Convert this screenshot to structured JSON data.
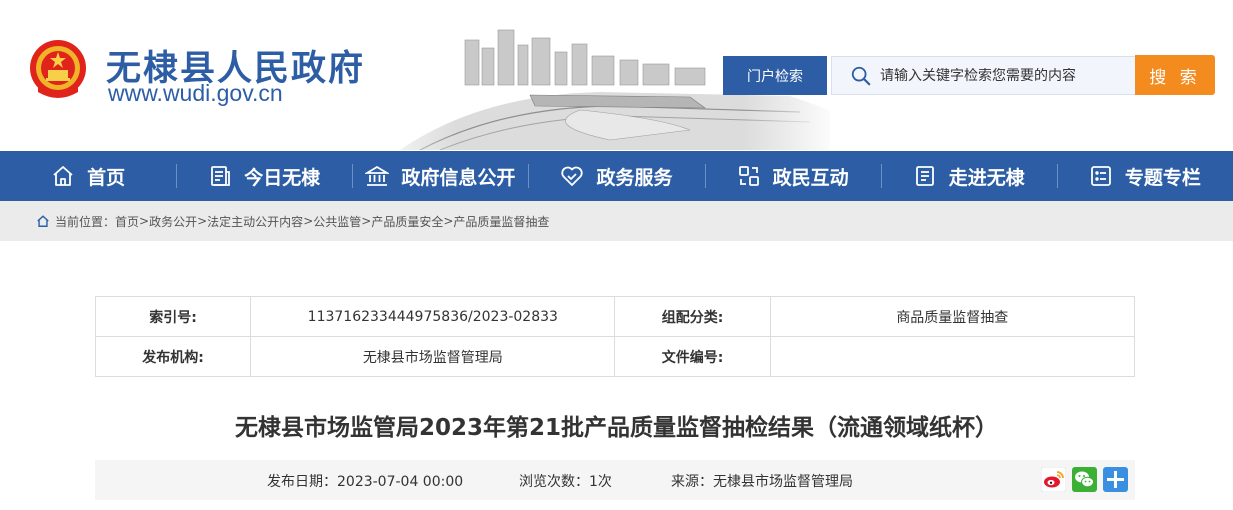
{
  "header": {
    "site_name": "无棣县人民政府",
    "site_url": "www.wudi.gov.cn",
    "portal_search_label": "门户检索",
    "search_placeholder": "请输入关键字检索您需要的内容",
    "search_button_label": "搜 索"
  },
  "nav": {
    "items": [
      {
        "label": "首页",
        "icon": "home-icon"
      },
      {
        "label": "今日无棣",
        "icon": "news-icon"
      },
      {
        "label": "政府信息公开",
        "icon": "government-building-icon"
      },
      {
        "label": "政务服务",
        "icon": "handshake-heart-icon"
      },
      {
        "label": "政民互动",
        "icon": "interaction-icon"
      },
      {
        "label": "走进无棣",
        "icon": "brochure-icon"
      },
      {
        "label": "专题专栏",
        "icon": "list-icon"
      }
    ]
  },
  "breadcrumb": {
    "prefix": "当前位置：",
    "items": [
      "首页",
      "政务公开",
      "法定主动公开内容",
      "公共监管",
      "产品质量安全",
      "产品质量监督抽查"
    ],
    "separator": ">"
  },
  "info_table": {
    "index_label": "索引号:",
    "index_value": "113716233444975836/2023-02833",
    "category_label": "组配分类:",
    "category_value": "商品质量监督抽查",
    "publisher_label": "发布机构:",
    "publisher_value": "无棣县市场监督管理局",
    "doc_number_label": "文件编号:",
    "doc_number_value": ""
  },
  "article": {
    "title": "无棣县市场监管局2023年第21批产品质量监督抽检结果（流通领域纸杯）",
    "publish_date_label": "发布日期：",
    "publish_date": "2023-07-04 00:00",
    "views_label": "浏览次数：",
    "views": "1次",
    "source_label": "来源：",
    "source": "无棣县市场监督管理局"
  },
  "share": {
    "icons": [
      "weibo-icon",
      "wechat-icon",
      "more-share-icon"
    ]
  },
  "colors": {
    "brand_blue": "#2d5ea5",
    "search_orange": "#f38b1e",
    "breadcrumb_bg": "#ebebeb",
    "meta_bg": "#f5f5f5"
  }
}
